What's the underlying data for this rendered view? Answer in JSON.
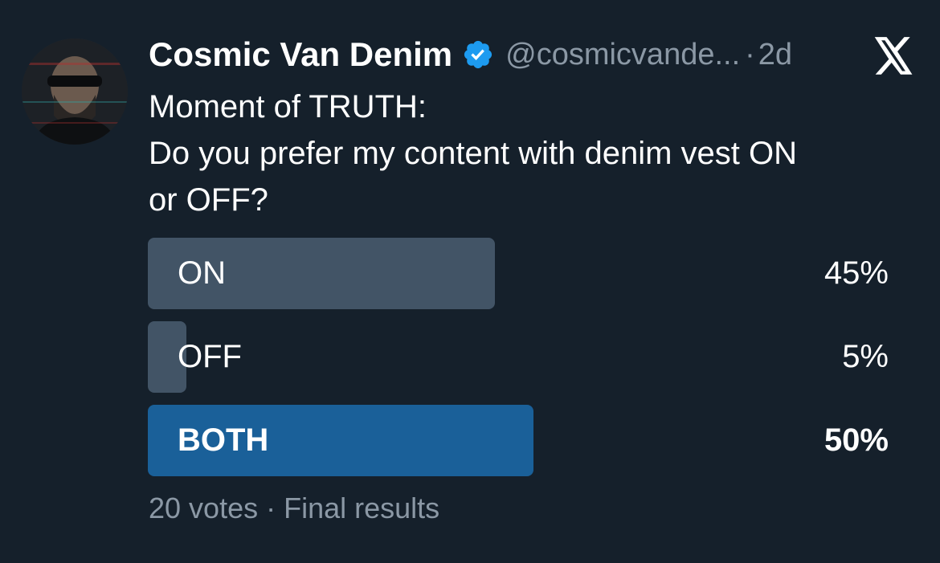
{
  "author": {
    "display_name": "Cosmic Van Denim",
    "handle": "@cosmicvande...",
    "separator": "·",
    "time_ago": "2d",
    "verified": true,
    "avatar_icon": "profile-photo-icon"
  },
  "platform_logo": "x-logo-icon",
  "tweet": {
    "lines": [
      "Moment of TRUTH:",
      "Do you prefer my content with denim vest ON",
      "or OFF?"
    ]
  },
  "poll": {
    "options": [
      {
        "label": "ON",
        "percent_text": "45%",
        "percent": 45,
        "winner": false
      },
      {
        "label": "OFF",
        "percent_text": "5%",
        "percent": 5,
        "winner": false
      },
      {
        "label": "BOTH",
        "percent_text": "50%",
        "percent": 50,
        "winner": true
      }
    ],
    "footer": "20 votes · Final results"
  },
  "colors": {
    "background": "#15202b",
    "bar": "#425466",
    "winner_bar": "#1a6099",
    "verified": "#1d9bf0",
    "muted_text": "#8b98a5"
  }
}
